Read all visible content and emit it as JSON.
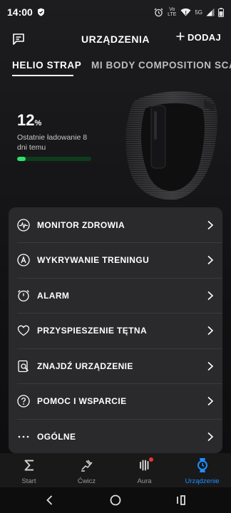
{
  "status_bar": {
    "time": "14:00",
    "network_text": "Vo LTE",
    "signal_text": "5G"
  },
  "header": {
    "title": "URZĄDZENIA",
    "add_label": "DODAJ"
  },
  "tabs": [
    {
      "label": "HELIO STRAP",
      "active": true
    },
    {
      "label": "MI BODY COMPOSITION SCALE",
      "active": false
    }
  ],
  "device": {
    "battery_value": "12",
    "battery_unit": "%",
    "battery_fraction": 0.12,
    "charge_info": "Ostatnie ładowanie 8 dni temu"
  },
  "menu": [
    {
      "label": "MONITOR ZDROWIA",
      "icon": "health-monitor-icon"
    },
    {
      "label": "WYKRYWANIE TRENINGU",
      "icon": "auto-detect-icon"
    },
    {
      "label": "ALARM",
      "icon": "alarm-icon"
    },
    {
      "label": "PRZYSPIESZENIE TĘTNA",
      "icon": "heart-icon"
    },
    {
      "label": "ZNAJDŹ URZĄDZENIE",
      "icon": "find-device-icon"
    },
    {
      "label": "POMOC I WSPARCIE",
      "icon": "help-icon"
    },
    {
      "label": "OGÓLNE",
      "icon": "more-icon"
    }
  ],
  "bottom_nav": [
    {
      "label": "Start",
      "icon": "sigma-icon",
      "active": false
    },
    {
      "label": "Ćwicz",
      "icon": "running-icon",
      "active": false
    },
    {
      "label": "Aura",
      "icon": "aura-icon",
      "active": false,
      "badge": true
    },
    {
      "label": "Urządzenie",
      "icon": "watch-icon",
      "active": true
    }
  ],
  "colors": {
    "accent": "#1f8fff",
    "battery": "#2ee06a",
    "badge": "#e33333",
    "card": "#2a2a2c"
  }
}
